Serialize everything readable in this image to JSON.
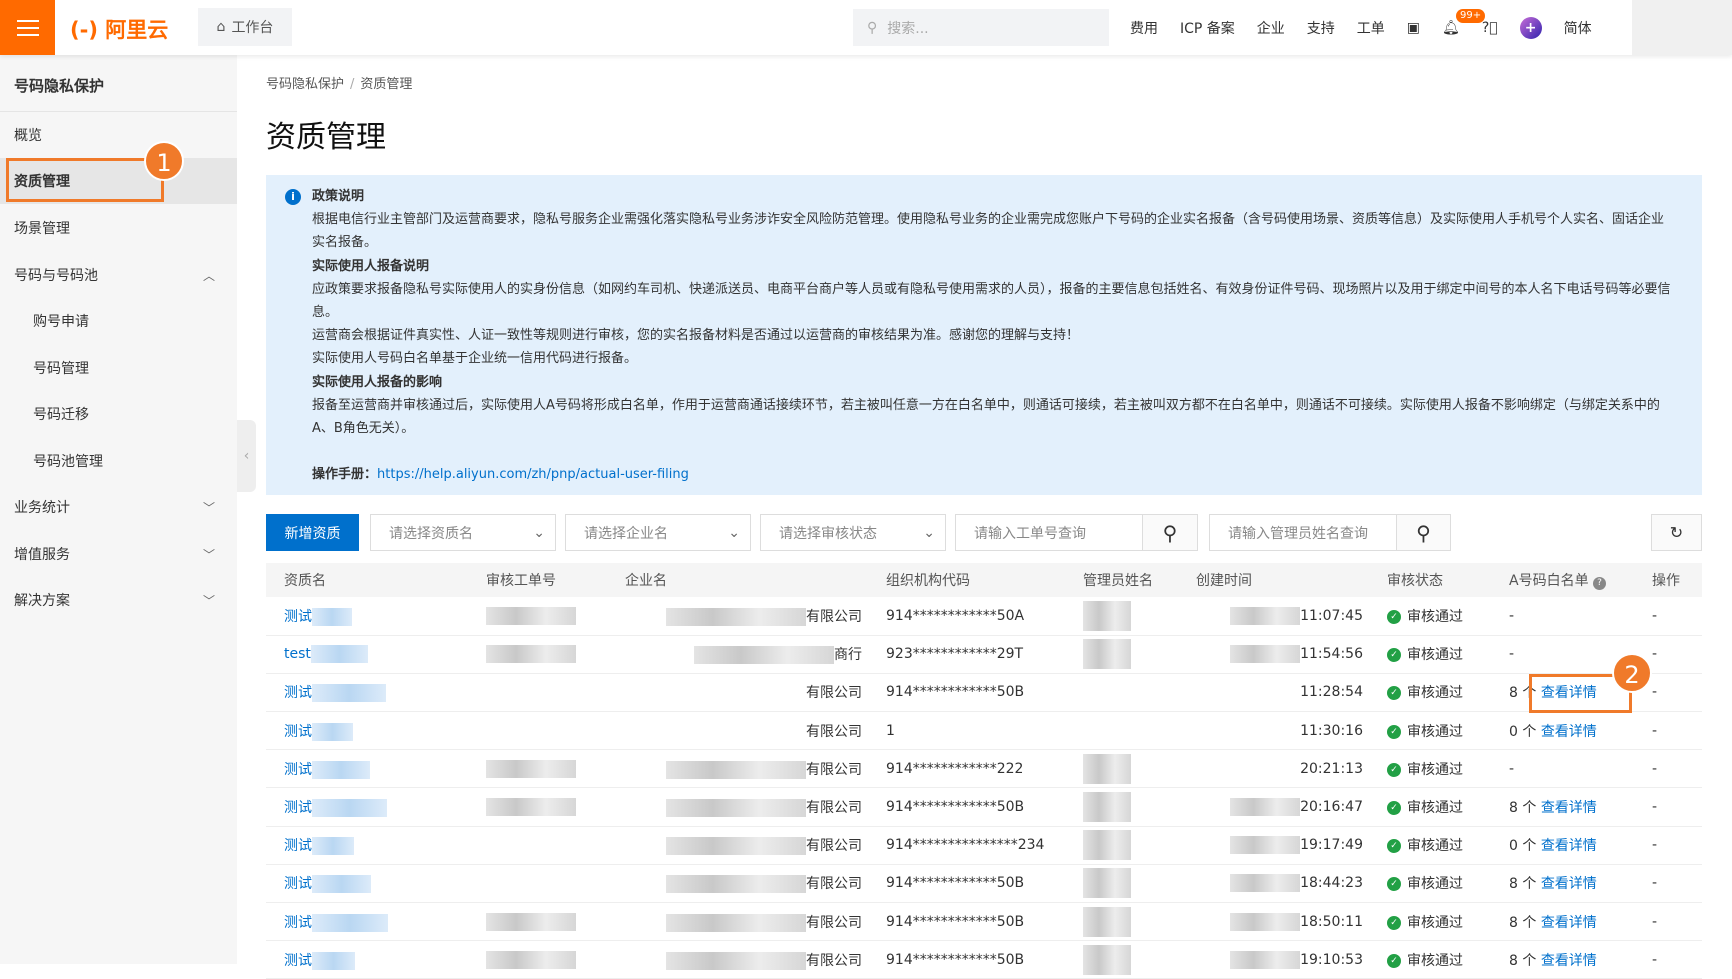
{
  "topbar": {
    "logo": "(-) 阿里云",
    "workbench": "工作台",
    "search_placeholder": "搜索...",
    "nav": [
      "费用",
      "ICP 备案",
      "企业",
      "支持",
      "工单"
    ],
    "badge": "99+",
    "lang": "简体"
  },
  "sidebar": {
    "title": "号码隐私保护",
    "items": [
      {
        "label": "概览"
      },
      {
        "label": "资质管理",
        "active": true
      },
      {
        "label": "场景管理"
      },
      {
        "label": "号码与号码池",
        "expanded": true
      },
      {
        "label": "购号申请",
        "sub": true
      },
      {
        "label": "号码管理",
        "sub": true
      },
      {
        "label": "号码迁移",
        "sub": true
      },
      {
        "label": "号码池管理",
        "sub": true
      },
      {
        "label": "业务统计"
      },
      {
        "label": "增值服务"
      },
      {
        "label": "解决方案"
      }
    ]
  },
  "breadcrumb": [
    "号码隐私保护",
    "资质管理"
  ],
  "page_title": "资质管理",
  "info": {
    "h1": "政策说明",
    "p1": "根据电信行业主管部门及运营商要求，隐私号服务企业需强化落实隐私号业务涉诈安全风险防范管理。使用隐私号业务的企业需完成您账户下号码的企业实名报备（含号码使用场景、资质等信息）及实际使用人手机号个人实名、固话企业实名报备。",
    "h2": "实际使用人报备说明",
    "p2": "应政策要求报备隐私号实际使用人的实身份信息（如网约车司机、快递派送员、电商平台商户等人员或有隐私号使用需求的人员），报备的主要信息包括姓名、有效身份证件号码、现场照片以及用于绑定中间号的本人名下电话号码等必要信息。",
    "p3": "运营商会根据证件真实性、人证一致性等规则进行审核，您的实名报备材料是否通过以运营商的审核结果为准。感谢您的理解与支持！",
    "p4": "实际使用人号码白名单基于企业统一信用代码进行报备。",
    "h3": "实际使用人报备的影响",
    "p5": "报备至运营商并审核通过后，实际使用人A号码将形成白名单，作用于运营商通话接续环节，若主被叫任意一方在白名单中，则通话可接续，若主被叫双方都不在白名单中，则通话不可接续。实际使用人报备不影响绑定（与绑定关系中的A、B角色无关）。",
    "manual_label": "操作手册：",
    "manual_link": "https://help.aliyun.com/zh/pnp/actual-user-filing"
  },
  "toolbar": {
    "add": "新增资质",
    "sel1": "请选择资质名",
    "sel2": "请选择企业名",
    "sel3": "请选择审核状态",
    "in1": "请输入工单号查询",
    "in2": "请输入管理员姓名查询"
  },
  "table": {
    "columns": [
      "资质名",
      "审核工单号",
      "企业名",
      "组织机构代码",
      "管理员姓名",
      "创建时间",
      "审核状态",
      "A号码白名单",
      "操作"
    ],
    "rows": [
      {
        "name": "测试",
        "company": "有限公司",
        "code": "914************50A",
        "time": "11:07:45",
        "status": "审核通过",
        "count": "-",
        "link": "",
        "op": "-"
      },
      {
        "name": "test",
        "company": "商行",
        "code": "923************29T",
        "time": "11:54:56",
        "status": "审核通过",
        "count": "-",
        "link": "",
        "op": "-"
      },
      {
        "name": "测试",
        "company": "有限公司",
        "code": "914************50B",
        "time": "11:28:54",
        "status": "审核通过",
        "count": "8 个",
        "link": "查看详情",
        "op": "-"
      },
      {
        "name": "测试",
        "company": "有限公司",
        "code": "1",
        "time": "11:30:16",
        "status": "审核通过",
        "count": "0 个",
        "link": "查看详情",
        "op": "-"
      },
      {
        "name": "测试",
        "company": "有限公司",
        "code": "914************222",
        "time": "20:21:13",
        "status": "审核通过",
        "count": "-",
        "link": "",
        "op": "-"
      },
      {
        "name": "测试",
        "company": "有限公司",
        "code": "914************50B",
        "time": "20:16:47",
        "status": "审核通过",
        "count": "8 个",
        "link": "查看详情",
        "op": "-"
      },
      {
        "name": "测试",
        "company": "有限公司",
        "code": "914***************234",
        "time": "19:17:49",
        "status": "审核通过",
        "count": "0 个",
        "link": "查看详情",
        "op": "-"
      },
      {
        "name": "测试",
        "company": "有限公司",
        "code": "914************50B",
        "time": "18:44:23",
        "status": "审核通过",
        "count": "8 个",
        "link": "查看详情",
        "op": "-"
      },
      {
        "name": "测试",
        "company": "有限公司",
        "code": "914************50B",
        "time": "18:50:11",
        "status": "审核通过",
        "count": "8 个",
        "link": "查看详情",
        "op": "-"
      },
      {
        "name": "测试",
        "company": "有限公司",
        "code": "914************50B",
        "time": "19:10:53",
        "status": "审核通过",
        "count": "8 个",
        "link": "查看详情",
        "op": "-"
      }
    ]
  },
  "annotations": [
    "1",
    "2"
  ],
  "colors": {
    "brand": "#ff6a00",
    "primary": "#0070cc",
    "annotation": "#f07a2a"
  }
}
